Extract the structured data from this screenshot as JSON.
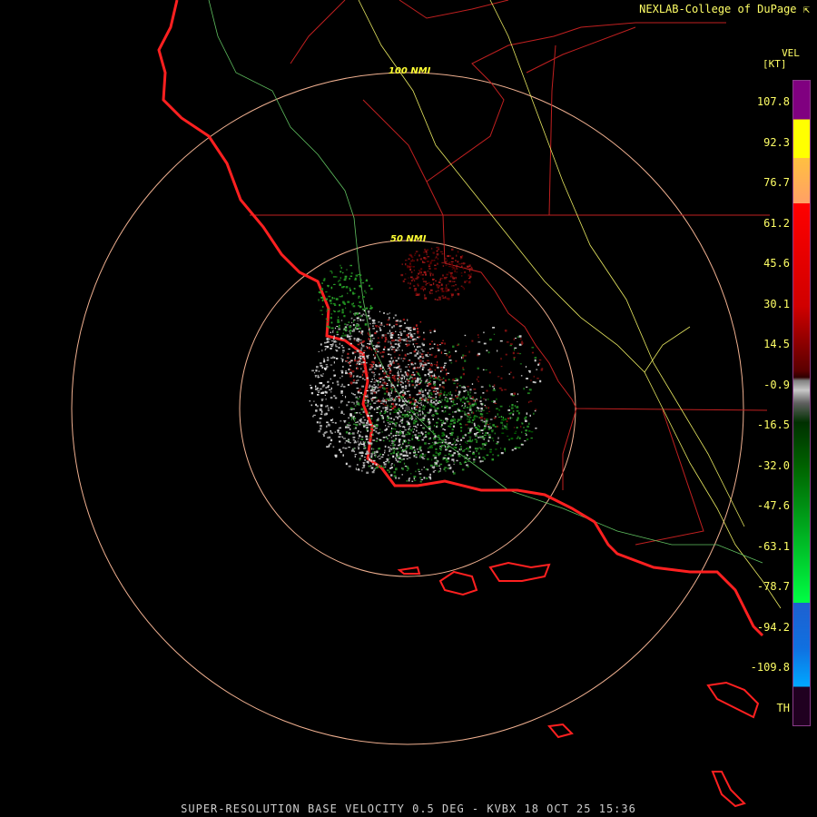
{
  "header": {
    "credit": "NEXLAB-College of DuPage",
    "credit_icon": "corner-arrow-icon"
  },
  "footer": {
    "title": "SUPER-RESOLUTION BASE VELOCITY 0.5 DEG - KVBX 18 OCT 25 15:36"
  },
  "legend": {
    "title": "VEL",
    "unit": "[KT]",
    "ticks": [
      "107.8",
      "92.3",
      "76.7",
      "61.2",
      "45.6",
      "30.1",
      "14.5",
      "-0.9",
      "-16.5",
      "-32.0",
      "-47.6",
      "-63.1",
      "-78.7",
      "-94.2",
      "-109.8",
      "TH"
    ],
    "colors": {
      "purple": "#800080",
      "yellow": "#ffff00",
      "orange": "#ffa066",
      "red": "#ff0000",
      "darkred": "#5a0000",
      "gray": "#c8c8c8",
      "darkgreen": "#006400",
      "green": "#00ff44",
      "blue": "#1e60d0",
      "cyan": "#00a8ff",
      "th": "#200020"
    }
  },
  "rings": [
    {
      "label": "50 NMI"
    },
    {
      "label": "100 NMI"
    }
  ],
  "map_colors": {
    "coast": "#ff2020",
    "county": "#c02020",
    "ring": "#f0b090",
    "road": "#e8e860",
    "river": "#60c060"
  }
}
